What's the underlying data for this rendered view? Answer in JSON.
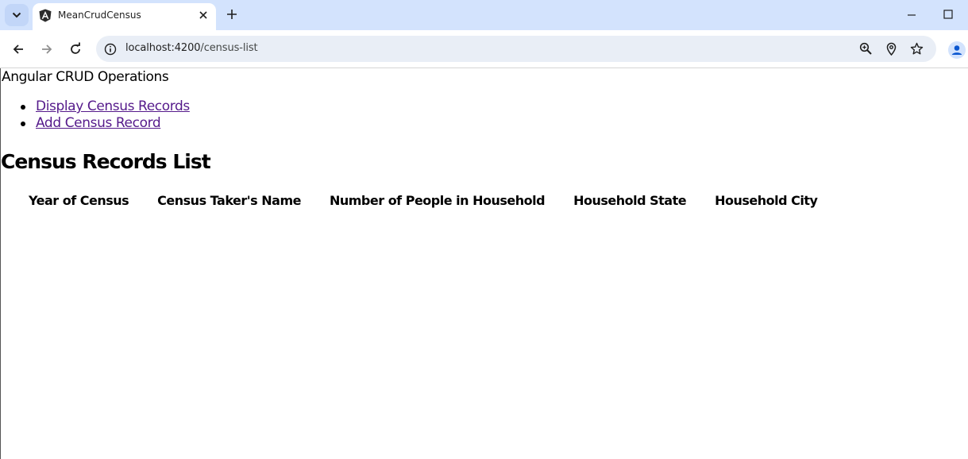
{
  "browser": {
    "tab": {
      "title": "MeanCrudCensus"
    },
    "address_bar": {
      "host": "localhost:4200",
      "path": "/census-list"
    }
  },
  "app": {
    "title": "Angular CRUD Operations",
    "nav_links": [
      "Display Census Records",
      "Add Census Record"
    ]
  },
  "main": {
    "heading": "Census Records List",
    "table_headers": [
      "Year of Census",
      "Census Taker's Name",
      "Number of People in Household",
      "Household State",
      "Household City"
    ],
    "rows": []
  },
  "colors": {
    "tabstrip": "#d3e3fd",
    "omnibox": "#e9eef6",
    "visited_link": "#551a8b",
    "profile_accent": "#0b57d0"
  }
}
